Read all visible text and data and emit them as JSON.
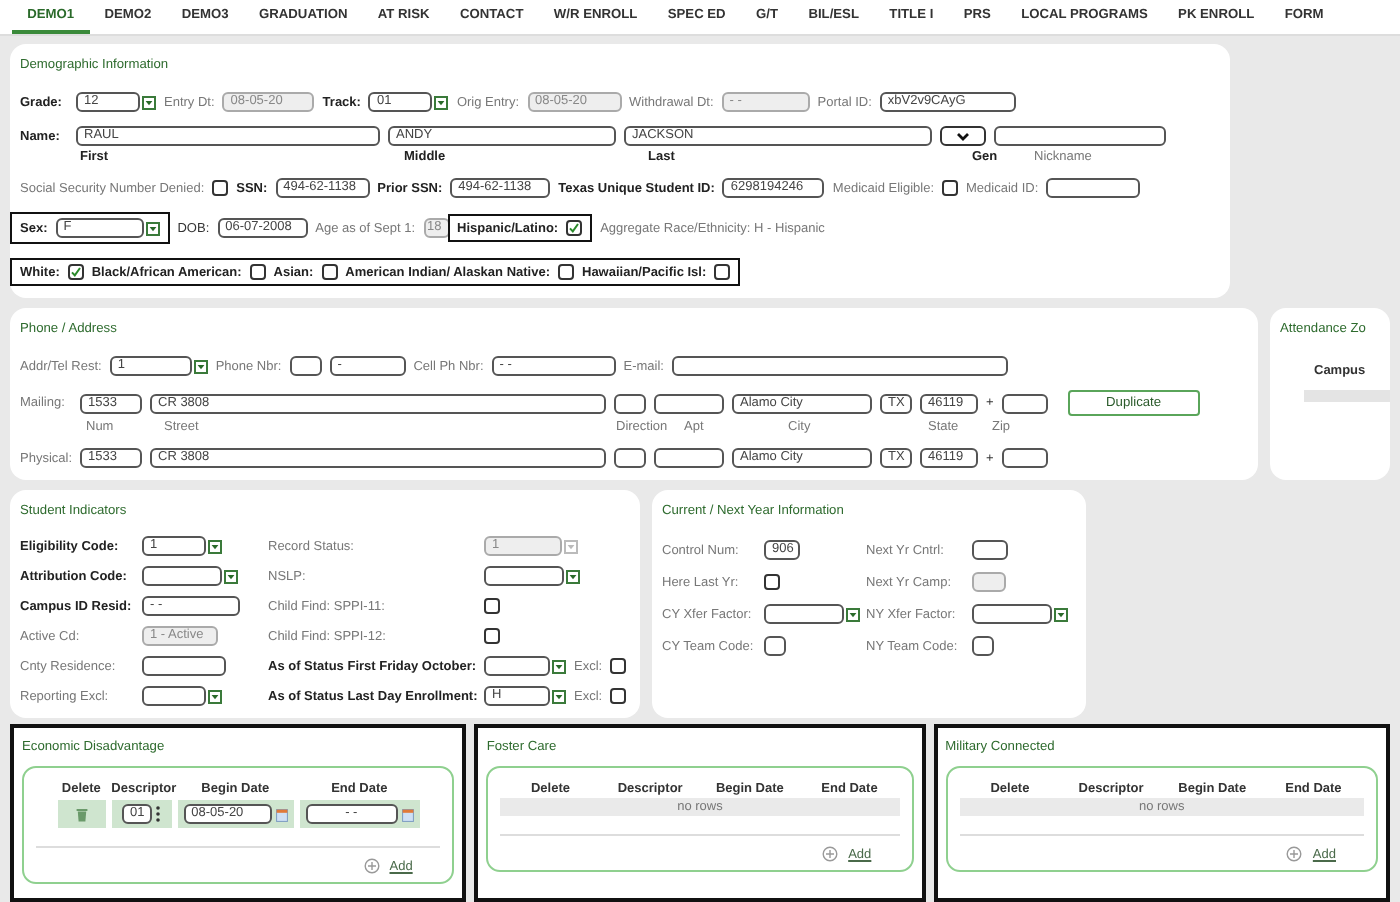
{
  "tabs": [
    {
      "label": "DEMO1",
      "selected": true
    },
    {
      "label": "DEMO2",
      "selected": false
    },
    {
      "label": "DEMO3",
      "selected": false
    },
    {
      "label": "GRADUATION",
      "selected": false
    },
    {
      "label": "AT RISK",
      "selected": false
    },
    {
      "label": "CONTACT",
      "selected": false
    },
    {
      "label": "W/R ENROLL",
      "selected": false
    },
    {
      "label": "SPEC ED",
      "selected": false
    },
    {
      "label": "G/T",
      "selected": false
    },
    {
      "label": "BIL/ESL",
      "selected": false
    },
    {
      "label": "TITLE I",
      "selected": false
    },
    {
      "label": "PRS",
      "selected": false
    },
    {
      "label": "LOCAL PROGRAMS",
      "selected": false
    },
    {
      "label": "PK ENROLL",
      "selected": false
    },
    {
      "label": "FORM",
      "selected": false
    }
  ],
  "demographic": {
    "title": "Demographic Information",
    "rows": [
      {
        "items": [
          {
            "kind": "strong",
            "text": "Grade:"
          },
          {
            "kind": "select",
            "value": "12",
            "disabled": false
          },
          {
            "kind": "label",
            "text": "Entry Dt:"
          },
          {
            "kind": "field",
            "value": "08-05-20",
            "disabled": true
          },
          {
            "kind": "strong",
            "text": "Track:"
          },
          {
            "kind": "select",
            "value": "01",
            "disabled": false
          },
          {
            "kind": "label",
            "text": "Orig Entry:"
          },
          {
            "kind": "field",
            "value": "08-05-20",
            "disabled": true
          },
          {
            "kind": "label",
            "text": "Withdrawal Dt:"
          },
          {
            "kind": "field",
            "value": "- -",
            "disabled": true
          },
          {
            "kind": "label",
            "text": "Portal ID:"
          },
          {
            "kind": "field",
            "value": "xbV2v9CAyG",
            "disabled": false
          }
        ]
      },
      {
        "items": [
          {
            "kind": "strong",
            "text": "Name:"
          },
          {
            "kind": "field",
            "value": "RAUL",
            "disabled": false
          },
          {
            "kind": "field",
            "value": "ANDY",
            "disabled": false
          },
          {
            "kind": "field",
            "value": "JACKSON",
            "disabled": false
          },
          {
            "kind": "dropdown"
          },
          {
            "kind": "field",
            "disabled": false
          }
        ]
      },
      {
        "items": [
          {
            "kind": "strong",
            "text": "First"
          },
          {
            "kind": "strong",
            "text": "Middle"
          },
          {
            "kind": "strong",
            "text": "Last"
          },
          {
            "kind": "strong",
            "text": "Gen"
          },
          {
            "kind": "label",
            "text": "Nickname"
          }
        ]
      },
      {
        "items": [
          {
            "kind": "label",
            "text": "Social Security Number Denied:"
          },
          {
            "kind": "checkbox",
            "checked": false
          },
          {
            "kind": "strong",
            "text": "SSN:"
          },
          {
            "kind": "field",
            "value": "494-62-1138",
            "disabled": false
          },
          {
            "kind": "strong",
            "text": "Prior SSN:"
          },
          {
            "kind": "field",
            "value": "494-62-1138",
            "disabled": false
          },
          {
            "kind": "strong",
            "text": "Texas Unique Student ID:"
          },
          {
            "kind": "field",
            "value": "6298194246",
            "disabled": false
          },
          {
            "kind": "label",
            "text": "Medicaid Eligible:"
          },
          {
            "kind": "checkbox",
            "checked": false
          },
          {
            "kind": "label",
            "text": "Medicaid ID:"
          },
          {
            "kind": "field",
            "disabled": false
          }
        ]
      },
      {
        "items": [
          {
            "kind": "frame",
            "items": [
              {
                "kind": "strong",
                "text": "Sex:"
              },
              {
                "kind": "select",
                "value": "F",
                "disabled": false
              }
            ]
          },
          {
            "kind": "text",
            "text": "DOB:"
          },
          {
            "kind": "field",
            "value": "06-07-2008",
            "disabled": false
          },
          {
            "kind": "label",
            "text": "Age as of Sept 1:"
          },
          {
            "kind": "field",
            "value": "18",
            "disabled": true
          },
          {
            "kind": "frame",
            "items": [
              {
                "kind": "strong",
                "text": "Hispanic/Latino:"
              },
              {
                "kind": "checkbox",
                "checked": true
              }
            ]
          },
          {
            "kind": "label",
            "text": "Aggregate Race/Ethnicity: H - Hispanic"
          }
        ]
      },
      {
        "items": [
          {
            "kind": "frame",
            "items": [
              {
                "kind": "strong",
                "text": "White:"
              },
              {
                "kind": "checkbox",
                "checked": true
              },
              {
                "kind": "strong",
                "text": "Black/African American:"
              },
              {
                "kind": "checkbox",
                "checked": false
              },
              {
                "kind": "strong",
                "text": "Asian:"
              },
              {
                "kind": "checkbox",
                "checked": false
              },
              {
                "kind": "strong",
                "text": "American Indian/ Alaskan Native:"
              },
              {
                "kind": "checkbox",
                "checked": false
              },
              {
                "kind": "strong",
                "text": "Hawaiian/Pacific Isl:"
              },
              {
                "kind": "checkbox",
                "checked": false
              }
            ]
          }
        ]
      }
    ]
  },
  "phone_address": {
    "title": "Phone / Address",
    "rows": [
      {
        "items": [
          {
            "kind": "label",
            "text": "Addr/Tel Rest:"
          },
          {
            "kind": "select",
            "value": "1",
            "disabled": false
          },
          {
            "kind": "label",
            "text": "Phone Nbr:"
          },
          {
            "kind": "field",
            "disabled": false
          },
          {
            "kind": "field",
            "value": "-",
            "disabled": false
          },
          {
            "kind": "label",
            "text": "Cell Ph Nbr:"
          },
          {
            "kind": "field",
            "value": "- -",
            "disabled": false
          },
          {
            "kind": "label",
            "text": "E-mail:"
          },
          {
            "kind": "field",
            "disabled": false
          }
        ]
      },
      {
        "items": [
          {
            "kind": "label",
            "text": "Mailing:"
          },
          {
            "kind": "field",
            "value": "1533",
            "disabled": false
          },
          {
            "kind": "field",
            "value": "CR 3808",
            "disabled": false
          },
          {
            "kind": "field",
            "disabled": false
          },
          {
            "kind": "field",
            "disabled": false
          },
          {
            "kind": "field",
            "value": "Alamo City",
            "disabled": false
          },
          {
            "kind": "field",
            "value": "TX",
            "disabled": false
          },
          {
            "kind": "field",
            "value": "46119",
            "disabled": false
          },
          {
            "kind": "text",
            "text": "+"
          },
          {
            "kind": "field",
            "disabled": false
          },
          {
            "kind": "button",
            "text": "Duplicate"
          }
        ]
      },
      {
        "items": [
          {
            "kind": "label",
            "text": "Num"
          },
          {
            "kind": "label",
            "text": "Street"
          },
          {
            "kind": "label",
            "text": "Direction"
          },
          {
            "kind": "label",
            "text": "Apt"
          },
          {
            "kind": "label",
            "text": "City"
          },
          {
            "kind": "label",
            "text": "State"
          },
          {
            "kind": "label",
            "text": "Zip"
          }
        ]
      },
      {
        "items": [
          {
            "kind": "label",
            "text": "Physical:"
          },
          {
            "kind": "field",
            "value": "1533",
            "disabled": false
          },
          {
            "kind": "field",
            "value": "CR 3808",
            "disabled": false
          },
          {
            "kind": "field",
            "disabled": false
          },
          {
            "kind": "field",
            "disabled": false
          },
          {
            "kind": "field",
            "value": "Alamo City",
            "disabled": false
          },
          {
            "kind": "field",
            "value": "TX",
            "disabled": false
          },
          {
            "kind": "field",
            "value": "46119",
            "disabled": false
          },
          {
            "kind": "text",
            "text": "+"
          },
          {
            "kind": "field",
            "disabled": false
          }
        ]
      }
    ]
  },
  "attendance_zone": {
    "title": "Attendance Zo",
    "columns": [
      "Campus"
    ]
  },
  "student_indicators": {
    "title": "Student Indicators",
    "rows": [
      {
        "items": [
          {
            "kind": "strong",
            "text": "Eligibility Code:"
          },
          {
            "kind": "select",
            "value": "1",
            "disabled": false
          },
          {
            "kind": "label",
            "text": "Record Status:"
          },
          {
            "kind": "select",
            "value": "1",
            "disabled": true
          }
        ]
      },
      {
        "items": [
          {
            "kind": "strong",
            "text": "Attribution Code:"
          },
          {
            "kind": "select",
            "disabled": false
          },
          {
            "kind": "label",
            "text": "NSLP:"
          },
          {
            "kind": "select",
            "disabled": false
          }
        ]
      },
      {
        "items": [
          {
            "kind": "strong",
            "text": "Campus ID Resid:"
          },
          {
            "kind": "field",
            "value": "- -",
            "disabled": false
          },
          {
            "kind": "label",
            "text": "Child Find: SPPI-11:"
          },
          {
            "kind": "checkbox",
            "checked": false
          }
        ]
      },
      {
        "items": [
          {
            "kind": "label",
            "text": "Active Cd:"
          },
          {
            "kind": "field",
            "value": "1 - Active",
            "disabled": true
          },
          {
            "kind": "label",
            "text": "Child Find: SPPI-12:"
          },
          {
            "kind": "checkbox",
            "checked": false
          }
        ]
      },
      {
        "items": [
          {
            "kind": "label",
            "text": "Cnty Residence:"
          },
          {
            "kind": "field",
            "disabled": false
          },
          {
            "kind": "strong",
            "text": "As of Status First Friday October:"
          },
          {
            "kind": "select",
            "disabled": false
          },
          {
            "kind": "label",
            "text": "Excl:"
          },
          {
            "kind": "checkbox",
            "checked": false
          }
        ]
      },
      {
        "items": [
          {
            "kind": "label",
            "text": "Reporting Excl:"
          },
          {
            "kind": "select",
            "disabled": false
          },
          {
            "kind": "strong",
            "text": "As of Status Last Day Enrollment:"
          },
          {
            "kind": "select",
            "value": "H",
            "disabled": false
          },
          {
            "kind": "label",
            "text": "Excl:"
          },
          {
            "kind": "checkbox",
            "checked": false
          }
        ]
      }
    ]
  },
  "current_next_year": {
    "title": "Current / Next Year Information",
    "rows": [
      {
        "items": [
          {
            "kind": "label",
            "text": "Control Num:"
          },
          {
            "kind": "field",
            "value": "906",
            "disabled": false
          },
          {
            "kind": "label",
            "text": "Next Yr Cntrl:"
          },
          {
            "kind": "field",
            "disabled": false
          }
        ]
      },
      {
        "items": [
          {
            "kind": "label",
            "text": "Here Last Yr:"
          },
          {
            "kind": "checkbox",
            "checked": false
          },
          {
            "kind": "label",
            "text": "Next Yr Camp:"
          },
          {
            "kind": "field",
            "disabled": true
          }
        ]
      },
      {
        "items": [
          {
            "kind": "label",
            "text": "CY Xfer Factor:"
          },
          {
            "kind": "select",
            "disabled": false
          },
          {
            "kind": "label",
            "text": "NY Xfer Factor:"
          },
          {
            "kind": "select",
            "disabled": false
          }
        ]
      },
      {
        "items": [
          {
            "kind": "label",
            "text": "CY Team Code:"
          },
          {
            "kind": "field",
            "disabled": false
          },
          {
            "kind": "label",
            "text": "NY Team Code:"
          },
          {
            "kind": "field",
            "disabled": false
          }
        ]
      }
    ]
  },
  "programs": [
    {
      "title": "Economic Disadvantage",
      "columns": [
        "Delete",
        "Descriptor",
        "Begin Date",
        "End Date"
      ],
      "rows": [
        {
          "descriptor": "01",
          "begin_date": "08-05-20",
          "end_date": "- -"
        }
      ],
      "add": "Add"
    },
    {
      "title": "Foster Care",
      "columns": [
        "Delete",
        "Descriptor",
        "Begin Date",
        "End Date"
      ],
      "empty_text": "no rows",
      "add": "Add"
    },
    {
      "title": "Military Connected",
      "columns": [
        "Delete",
        "Descriptor",
        "Begin Date",
        "End Date"
      ],
      "empty_text": "no rows",
      "add": "Add"
    }
  ]
}
